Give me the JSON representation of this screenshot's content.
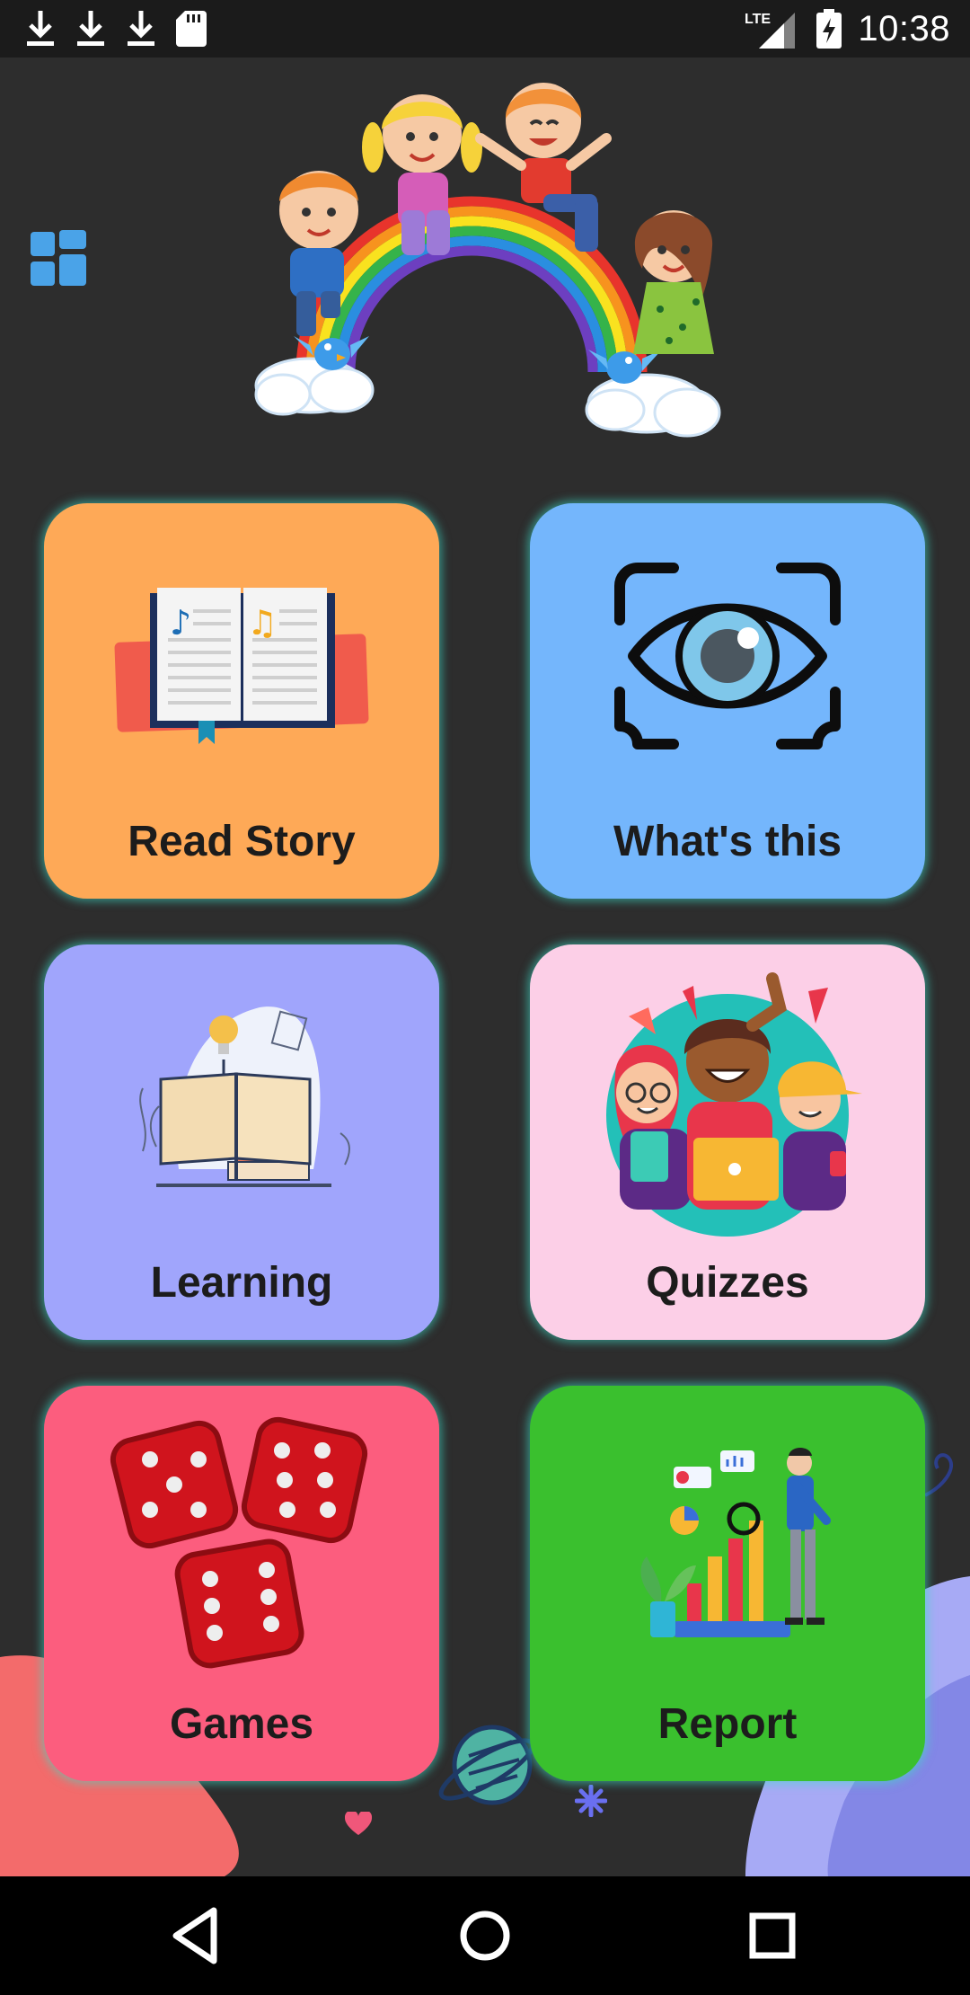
{
  "status_bar": {
    "time": "10:38",
    "network": "LTE",
    "icons": [
      "download-icon",
      "download-icon",
      "download-icon",
      "sd-card-icon",
      "lte-signal-icon",
      "battery-charging-icon"
    ]
  },
  "header": {
    "menu_icon": "grid-menu-icon",
    "hero_image": "kids-on-rainbow-illustration"
  },
  "tiles": [
    {
      "label": "Read Story",
      "color": "#fea957",
      "icon": "open-book-icon"
    },
    {
      "label": "What's this",
      "color": "#74b6fc",
      "icon": "eye-scan-icon"
    },
    {
      "label": "Learning",
      "color": "#a0a5fc",
      "icon": "books-lightbulb-icon"
    },
    {
      "label": "Quizzes",
      "color": "#fccfe7",
      "icon": "happy-kids-icon"
    },
    {
      "label": "Games",
      "color": "#fc5d7e",
      "icon": "dice-icon"
    },
    {
      "label": "Report",
      "color": "#3ac02e",
      "icon": "chart-report-icon"
    }
  ],
  "nav_bar": {
    "icons": [
      "back-icon",
      "home-icon",
      "recents-icon"
    ]
  }
}
